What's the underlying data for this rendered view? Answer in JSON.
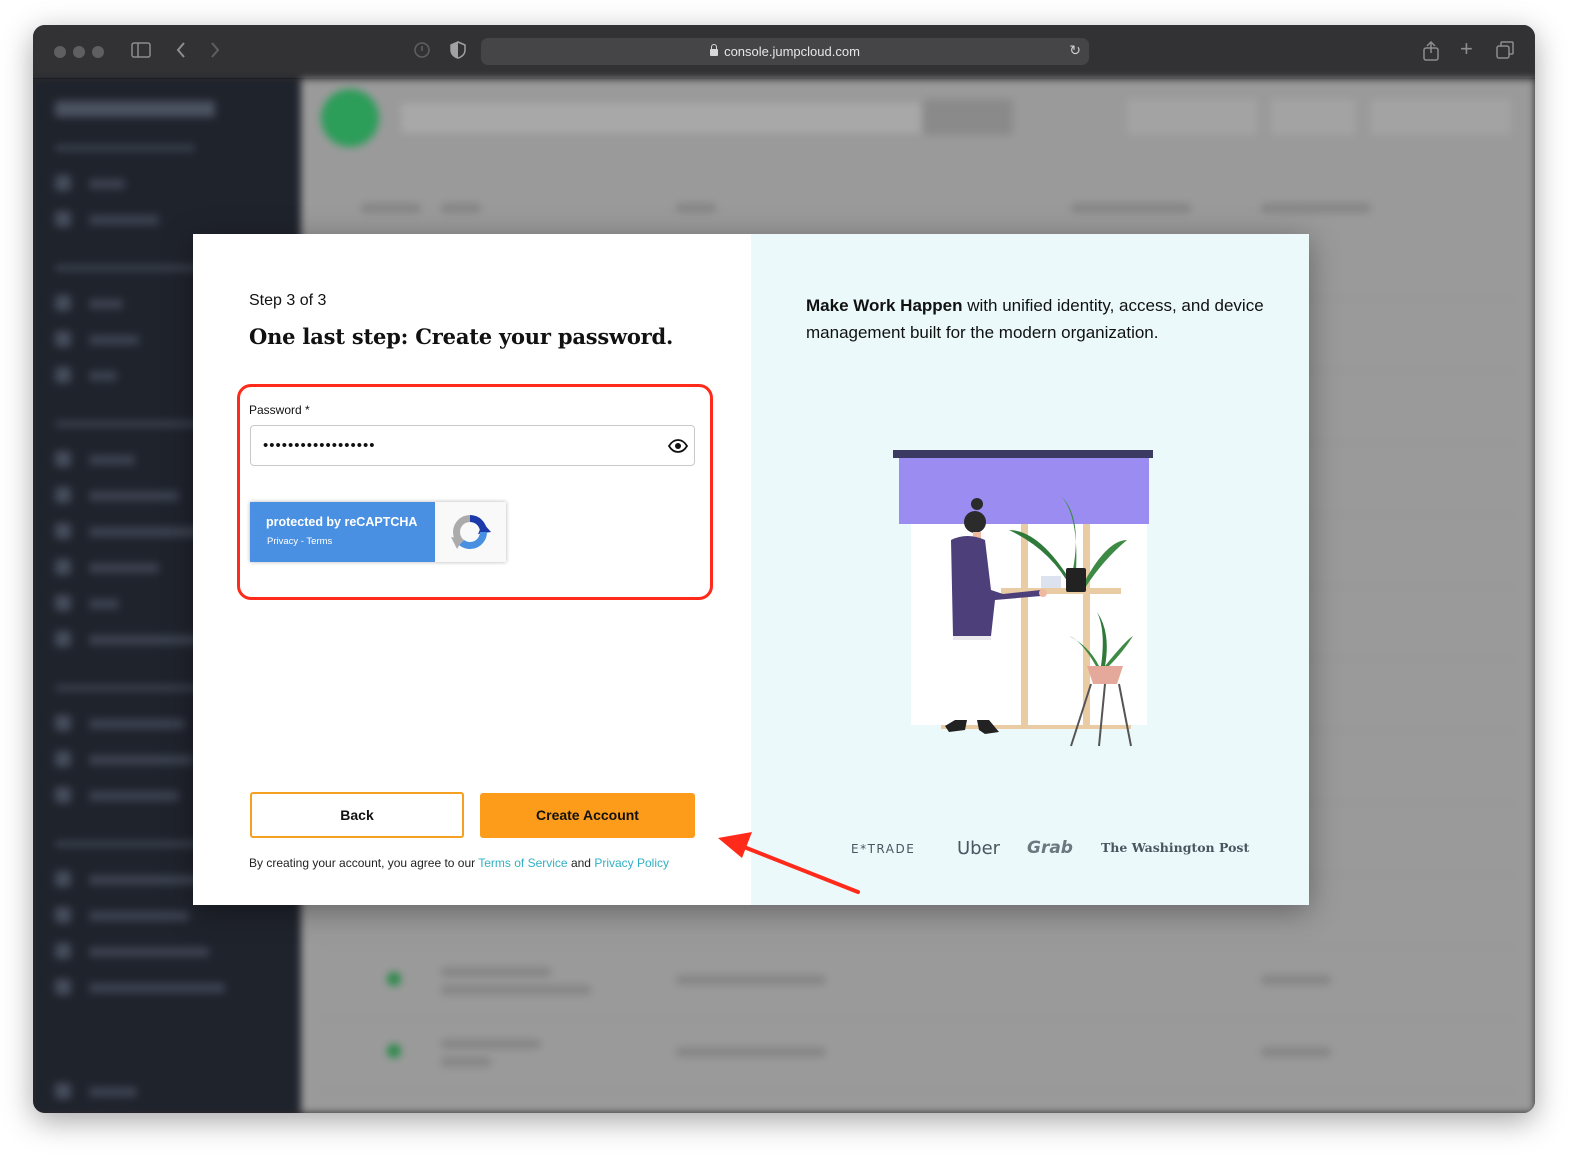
{
  "browser": {
    "url": "console.jumpcloud.com"
  },
  "modal": {
    "step_label": "Step 3 of 3",
    "title": "One last step: Create your password.",
    "password": {
      "label": "Password *",
      "value": "••••••••••••••••••"
    },
    "recaptcha": {
      "main": "protected by reCAPTCHA",
      "sub": "Privacy - Terms"
    },
    "back_label": "Back",
    "create_label": "Create Account",
    "terms": {
      "prefix": "By creating your account, you agree to our ",
      "tos_link": "Terms of Service",
      "middle": " and ",
      "privacy_link": "Privacy Policy"
    }
  },
  "promo": {
    "tagline_bold": "Make Work Happen",
    "tagline_rest": " with unified identity, access, and device management built for the modern organization.",
    "logos": [
      "E*TRADE",
      "Uber",
      "Grab",
      "The Washington Post"
    ]
  },
  "colors": {
    "accent_orange": "#fd9c1b",
    "annotation_red": "#ff2a1a",
    "link_teal": "#31b0c4",
    "recaptcha_blue": "#4a90e2",
    "promo_bg": "#ebf9fa"
  }
}
